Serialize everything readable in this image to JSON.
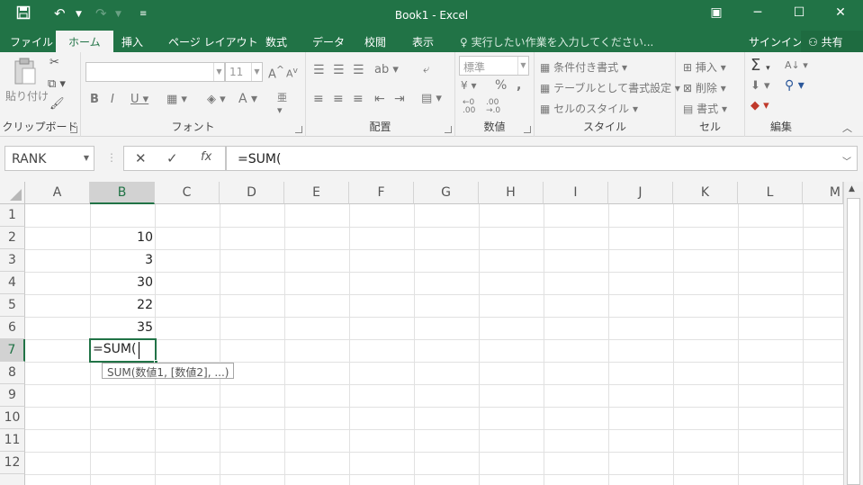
{
  "app": {
    "title": "Book1 - Excel"
  },
  "tabs": [
    "ファイル",
    "ホーム",
    "挿入",
    "ページ レイアウト",
    "数式",
    "データ",
    "校閲",
    "表示"
  ],
  "tell_me": "実行したい作業を入力してください...",
  "sign_in": "サインイン",
  "share": "共有",
  "clipboard": {
    "paste": "貼り付け",
    "label": "クリップボード"
  },
  "font": {
    "size": "11",
    "label": "フォント",
    "bold": "B",
    "italic": "I",
    "underline": "U",
    "font_color": "A",
    "grow": "A",
    "shrink": "A"
  },
  "alignment": {
    "label": "配置"
  },
  "number": {
    "format": "標準",
    "label": "数値",
    "percent": "%",
    "comma": ","
  },
  "styles": {
    "conditional": "条件付き書式",
    "table": "テーブルとして書式設定",
    "cell_styles": "セルのスタイル",
    "label": "スタイル"
  },
  "cells": {
    "insert": "挿入",
    "delete": "削除",
    "format": "書式",
    "label": "セル"
  },
  "editing": {
    "label": "編集"
  },
  "formula_bar": {
    "name_box": "RANK",
    "formula": "=SUM(",
    "cancel": "✕",
    "enter": "✓",
    "fx": "fx"
  },
  "columns": [
    "A",
    "B",
    "C",
    "D",
    "E",
    "F",
    "G",
    "H",
    "I",
    "J",
    "K",
    "L",
    "M"
  ],
  "rows": [
    "1",
    "2",
    "3",
    "4",
    "5",
    "6",
    "7",
    "8",
    "9",
    "10",
    "11",
    "12"
  ],
  "cells_data": {
    "B2": "10",
    "B3": "3",
    "B4": "30",
    "B5": "22",
    "B6": "35",
    "B7": "=SUM("
  },
  "tooltip": "SUM(数値1, [数値2], ...)",
  "colors": {
    "excel_green": "#217346",
    "ribbon_bg": "#f3f3f3",
    "active_cell_border": "#217346"
  }
}
